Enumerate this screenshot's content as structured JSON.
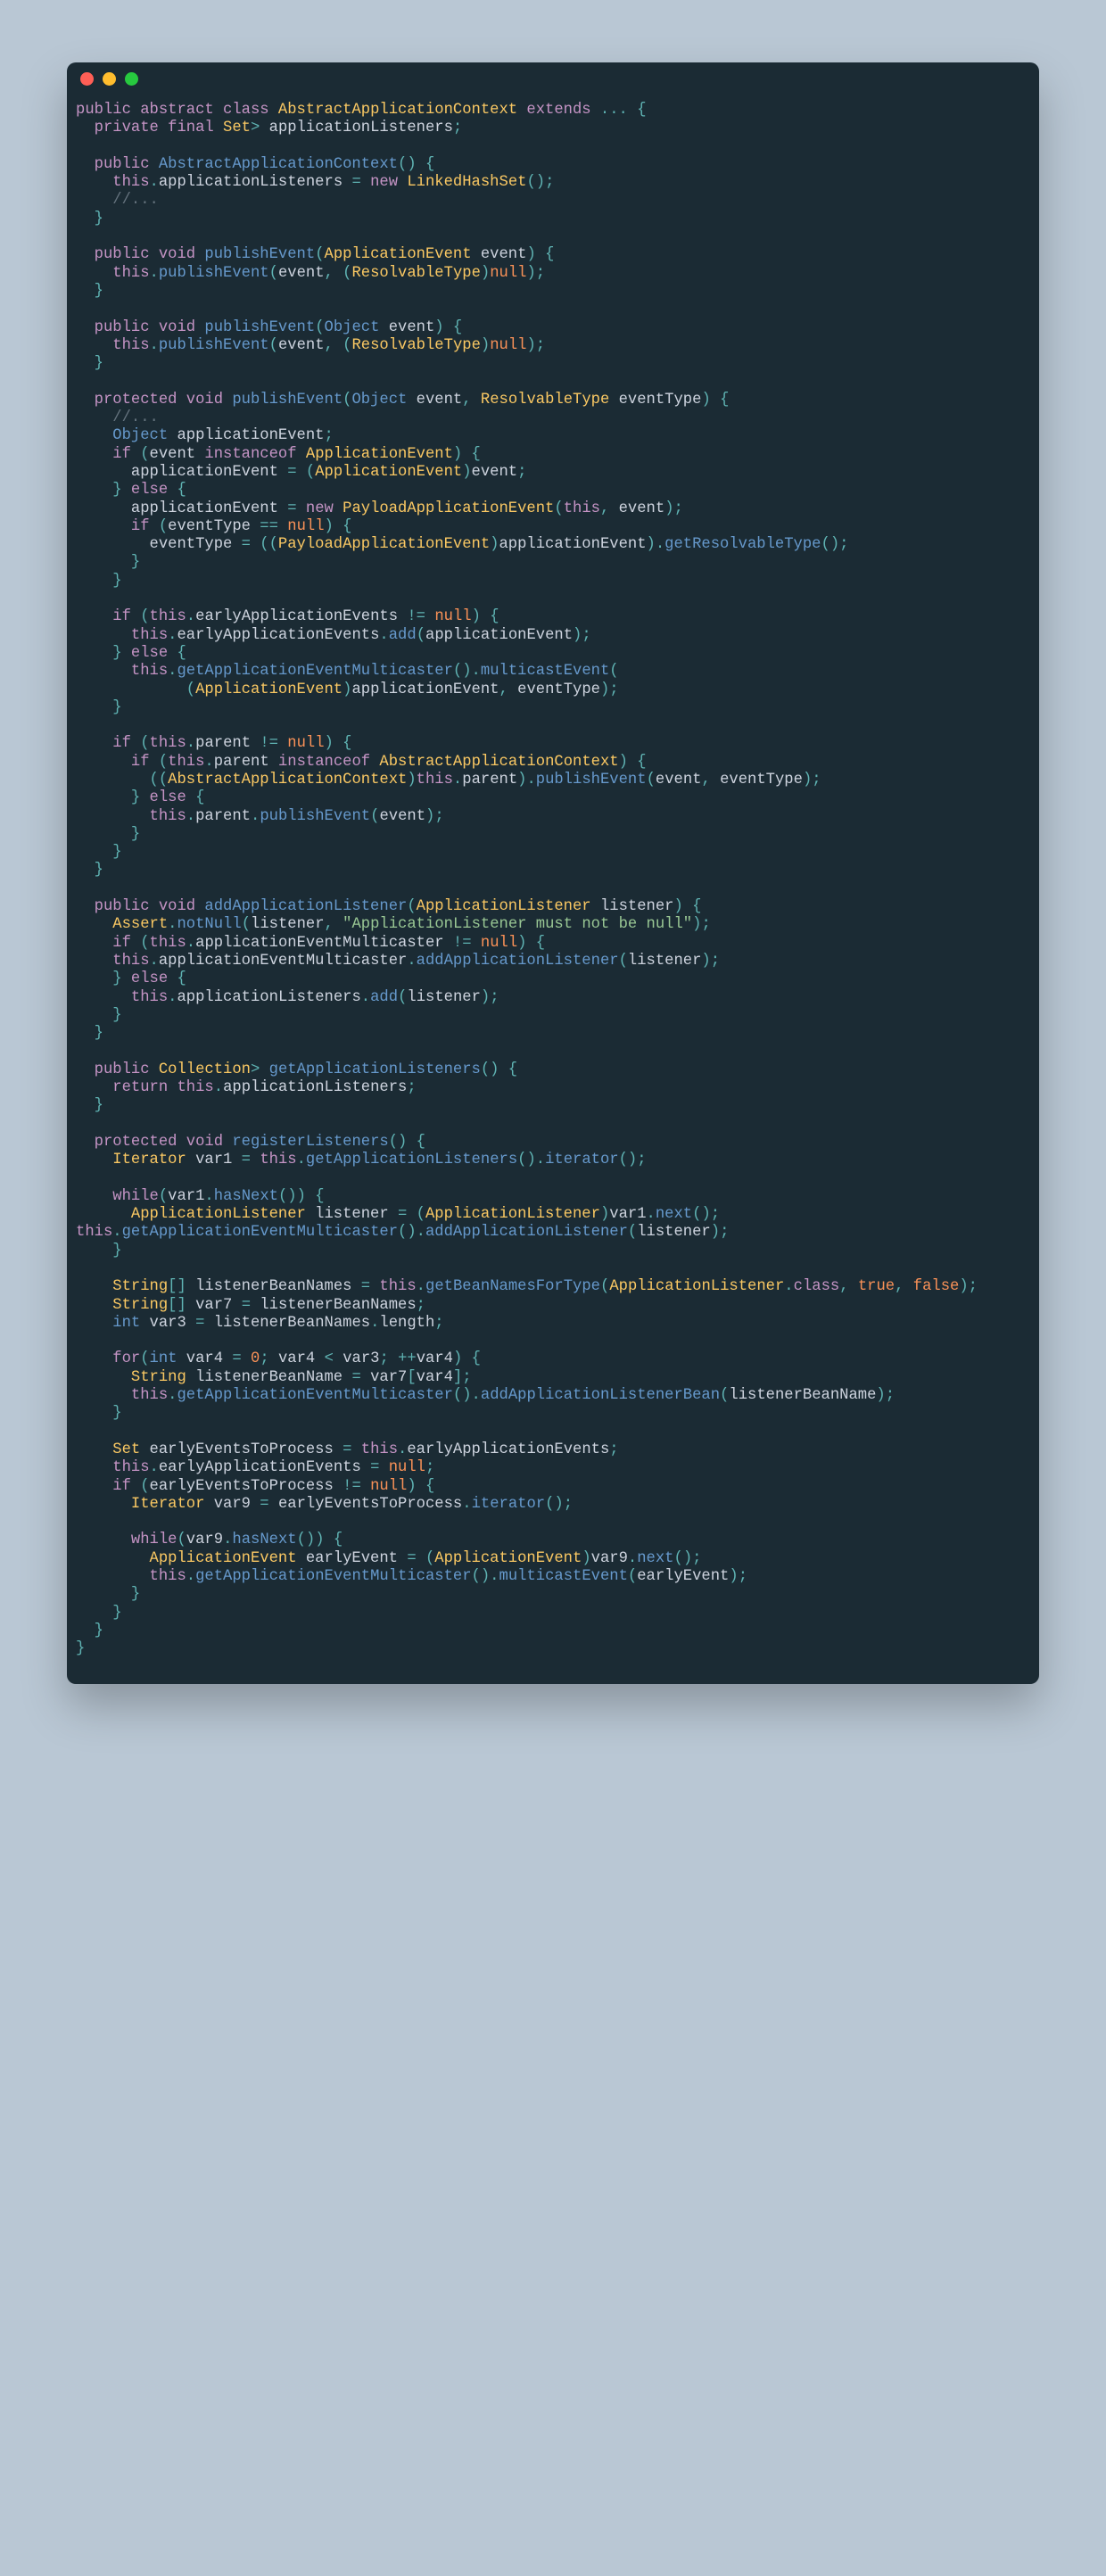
{
  "window": {
    "dots": [
      "red",
      "yellow",
      "green"
    ]
  },
  "code": {
    "l01": {
      "a": "public abstract class ",
      "b": "AbstractApplicationContext",
      "c": " extends ",
      "d": "...",
      "e": " {"
    },
    "l02": {
      "a": "  private final ",
      "b": "Set",
      "c": "> ",
      "d": "applicationListeners",
      "e": ";"
    },
    "l03": "",
    "l04": {
      "a": "  public ",
      "b": "AbstractApplicationContext",
      "c": "() {"
    },
    "l05": {
      "a": "    this",
      "b": ".",
      "c": "applicationListeners",
      "d": " = ",
      "e": "new ",
      "f": "LinkedHashSet",
      "g": "();"
    },
    "l06": {
      "a": "    //..."
    },
    "l07": {
      "a": "  }"
    },
    "l08": "",
    "l09": {
      "a": "  public ",
      "b": "void ",
      "c": "publishEvent",
      "d": "(",
      "e": "ApplicationEvent ",
      "f": "event",
      "g": ") {"
    },
    "l10": {
      "a": "    this",
      "b": ".",
      "c": "publishEvent",
      "d": "(",
      "e": "event",
      "f": ", (",
      "g": "ResolvableType",
      "h": ")",
      "i": "null",
      "j": ");"
    },
    "l11": {
      "a": "  }"
    },
    "l12": "",
    "l13": {
      "a": "  public ",
      "b": "void ",
      "c": "publishEvent",
      "d": "(",
      "e": "Object ",
      "f": "event",
      "g": ") {"
    },
    "l14": {
      "a": "    this",
      "b": ".",
      "c": "publishEvent",
      "d": "(",
      "e": "event",
      "f": ", (",
      "g": "ResolvableType",
      "h": ")",
      "i": "null",
      "j": ");"
    },
    "l15": {
      "a": "  }"
    },
    "l16": "",
    "l17": {
      "a": "  protected ",
      "b": "void ",
      "c": "publishEvent",
      "d": "(",
      "e": "Object ",
      "f": "event",
      "g": ", ",
      "h": "ResolvableType ",
      "i": "eventType",
      "j": ") {"
    },
    "l18": {
      "a": "    //..."
    },
    "l19": {
      "a": "    Object ",
      "b": "applicationEvent",
      "c": ";"
    },
    "l20": {
      "a": "    if ",
      "b": "(",
      "c": "event",
      "d": " instanceof ",
      "e": "ApplicationEvent",
      "f": ") {"
    },
    "l21": {
      "a": "      applicationEvent",
      "b": " = (",
      "c": "ApplicationEvent",
      "d": ")",
      "e": "event",
      "f": ";"
    },
    "l22": {
      "a": "    } ",
      "b": "else ",
      "c": "{"
    },
    "l23": {
      "a": "      applicationEvent",
      "b": " = ",
      "c": "new ",
      "d": "PayloadApplicationEvent",
      "e": "(",
      "f": "this",
      "g": ", ",
      "h": "event",
      "i": ");"
    },
    "l24": {
      "a": "      if ",
      "b": "(",
      "c": "eventType",
      "d": " == ",
      "e": "null",
      "f": ") {"
    },
    "l25": {
      "a": "        eventType",
      "b": " = ((",
      "c": "PayloadApplicationEvent",
      "d": ")",
      "e": "applicationEvent",
      "f": ").",
      "g": "getResolvableType",
      "h": "();"
    },
    "l26": {
      "a": "      }"
    },
    "l27": {
      "a": "    }"
    },
    "l28": "",
    "l29": {
      "a": "    if ",
      "b": "(",
      "c": "this",
      "d": ".",
      "e": "earlyApplicationEvents",
      "f": " != ",
      "g": "null",
      "h": ") {"
    },
    "l30": {
      "a": "      this",
      "b": ".",
      "c": "earlyApplicationEvents",
      "d": ".",
      "e": "add",
      "f": "(",
      "g": "applicationEvent",
      "h": ");"
    },
    "l31": {
      "a": "    } ",
      "b": "else ",
      "c": "{"
    },
    "l32": {
      "a": "      this",
      "b": ".",
      "c": "getApplicationEventMulticaster",
      "d": "().",
      "e": "multicastEvent",
      "f": "("
    },
    "l33": {
      "a": "            (",
      "b": "ApplicationEvent",
      "c": ")",
      "d": "applicationEvent",
      "e": ", ",
      "f": "eventType",
      "g": ");"
    },
    "l34": {
      "a": "    }"
    },
    "l35": "",
    "l36": {
      "a": "    if ",
      "b": "(",
      "c": "this",
      "d": ".",
      "e": "parent",
      "f": " != ",
      "g": "null",
      "h": ") {"
    },
    "l37": {
      "a": "      if ",
      "b": "(",
      "c": "this",
      "d": ".",
      "e": "parent",
      "f": " instanceof ",
      "g": "AbstractApplicationContext",
      "h": ") {"
    },
    "l38": {
      "a": "        ((",
      "b": "AbstractApplicationContext",
      "c": ")",
      "d": "this",
      "e": ".",
      "f": "parent",
      "g": ").",
      "h": "publishEvent",
      "i": "(",
      "j": "event",
      "k": ", ",
      "l": "eventType",
      "m": ");"
    },
    "l39": {
      "a": "      } ",
      "b": "else ",
      "c": "{"
    },
    "l40": {
      "a": "        this",
      "b": ".",
      "c": "parent",
      "d": ".",
      "e": "publishEvent",
      "f": "(",
      "g": "event",
      "h": ");"
    },
    "l41": {
      "a": "      }"
    },
    "l42": {
      "a": "    }"
    },
    "l43": {
      "a": "  }"
    },
    "l44": "",
    "l45": {
      "a": "  public ",
      "b": "void ",
      "c": "addApplicationListener",
      "d": "(",
      "e": "ApplicationListener ",
      "f": "listener",
      "g": ") {"
    },
    "l46": {
      "a": "    Assert",
      "b": ".",
      "c": "notNull",
      "d": "(",
      "e": "listener",
      "f": ", ",
      "g": "\"ApplicationListener must not be null\"",
      "h": ");"
    },
    "l47": {
      "a": "    if ",
      "b": "(",
      "c": "this",
      "d": ".",
      "e": "applicationEventMulticaster",
      "f": " != ",
      "g": "null",
      "h": ") {"
    },
    "l48": {
      "a": "    this",
      "b": ".",
      "c": "applicationEventMulticaster",
      "d": ".",
      "e": "addApplicationListener",
      "f": "(",
      "g": "listener",
      "h": ");"
    },
    "l49": {
      "a": "    } ",
      "b": "else ",
      "c": "{"
    },
    "l50": {
      "a": "      this",
      "b": ".",
      "c": "applicationListeners",
      "d": ".",
      "e": "add",
      "f": "(",
      "g": "listener",
      "h": ");"
    },
    "l51": {
      "a": "    }"
    },
    "l52": {
      "a": "  }"
    },
    "l53": "",
    "l54": {
      "a": "  public ",
      "b": "Collection",
      "c": "> ",
      "d": "getApplicationListeners",
      "e": "() {"
    },
    "l55": {
      "a": "    return ",
      "b": "this",
      "c": ".",
      "d": "applicationListeners",
      "e": ";"
    },
    "l56": {
      "a": "  }"
    },
    "l57": "",
    "l58": {
      "a": "  protected ",
      "b": "void ",
      "c": "registerListeners",
      "d": "() {"
    },
    "l59": {
      "a": "    Iterator ",
      "b": "var1",
      "c": " = ",
      "d": "this",
      "e": ".",
      "f": "getApplicationListeners",
      "g": "().",
      "h": "iterator",
      "i": "();"
    },
    "l60": "",
    "l61": {
      "a": "    while",
      "b": "(",
      "c": "var1",
      "d": ".",
      "e": "hasNext",
      "f": "()) {"
    },
    "l62": {
      "a": "      ApplicationListener ",
      "b": "listener",
      "c": " = (",
      "d": "ApplicationListener",
      "e": ")",
      "f": "var1",
      "g": ".",
      "h": "next",
      "i": "();"
    },
    "l63": {
      "a": "this",
      "b": ".",
      "c": "getApplicationEventMulticaster",
      "d": "().",
      "e": "addApplicationListener",
      "f": "(",
      "g": "listener",
      "h": ");"
    },
    "l64": {
      "a": "    }"
    },
    "l65": "",
    "l66": {
      "a": "    String",
      "b": "[] ",
      "c": "listenerBeanNames",
      "d": " = ",
      "e": "this",
      "f": ".",
      "g": "getBeanNamesForType",
      "h": "(",
      "i": "ApplicationListener",
      "j": ".",
      "k": "class",
      "l": ", ",
      "m": "true",
      "n": ", ",
      "o": "false",
      "p": ");"
    },
    "l67": {
      "a": "    String",
      "b": "[] ",
      "c": "var7",
      "d": " = ",
      "e": "listenerBeanNames",
      "f": ";"
    },
    "l68": {
      "a": "    int ",
      "b": "var3",
      "c": " = ",
      "d": "listenerBeanNames",
      "e": ".",
      "f": "length",
      "g": ";"
    },
    "l69": "",
    "l70": {
      "a": "    for",
      "b": "(",
      "c": "int ",
      "d": "var4",
      "e": " = ",
      "f": "0",
      "g": "; ",
      "h": "var4",
      "i": " < ",
      "j": "var3",
      "k": "; ++",
      "l": "var4",
      "m": ") {"
    },
    "l71": {
      "a": "      String ",
      "b": "listenerBeanName",
      "c": " = ",
      "d": "var7",
      "e": "[",
      "f": "var4",
      "g": "];"
    },
    "l72": {
      "a": "      this",
      "b": ".",
      "c": "getApplicationEventMulticaster",
      "d": "().",
      "e": "addApplicationListenerBean",
      "f": "(",
      "g": "listenerBeanName",
      "h": ");"
    },
    "l73": {
      "a": "    }"
    },
    "l74": "",
    "l75": {
      "a": "    Set ",
      "b": "earlyEventsToProcess",
      "c": " = ",
      "d": "this",
      "e": ".",
      "f": "earlyApplicationEvents",
      "g": ";"
    },
    "l76": {
      "a": "    this",
      "b": ".",
      "c": "earlyApplicationEvents",
      "d": " = ",
      "e": "null",
      "f": ";"
    },
    "l77": {
      "a": "    if ",
      "b": "(",
      "c": "earlyEventsToProcess",
      "d": " != ",
      "e": "null",
      "f": ") {"
    },
    "l78": {
      "a": "      Iterator ",
      "b": "var9",
      "c": " = ",
      "d": "earlyEventsToProcess",
      "e": ".",
      "f": "iterator",
      "g": "();"
    },
    "l79": "",
    "l80": {
      "a": "      while",
      "b": "(",
      "c": "var9",
      "d": ".",
      "e": "hasNext",
      "f": "()) {"
    },
    "l81": {
      "a": "        ApplicationEvent ",
      "b": "earlyEvent",
      "c": " = (",
      "d": "ApplicationEvent",
      "e": ")",
      "f": "var9",
      "g": ".",
      "h": "next",
      "i": "();"
    },
    "l82": {
      "a": "        this",
      "b": ".",
      "c": "getApplicationEventMulticaster",
      "d": "().",
      "e": "multicastEvent",
      "f": "(",
      "g": "earlyEvent",
      "h": ");"
    },
    "l83": {
      "a": "      }"
    },
    "l84": {
      "a": "    }"
    },
    "l85": {
      "a": "  }"
    },
    "l86": {
      "a": "}"
    }
  }
}
